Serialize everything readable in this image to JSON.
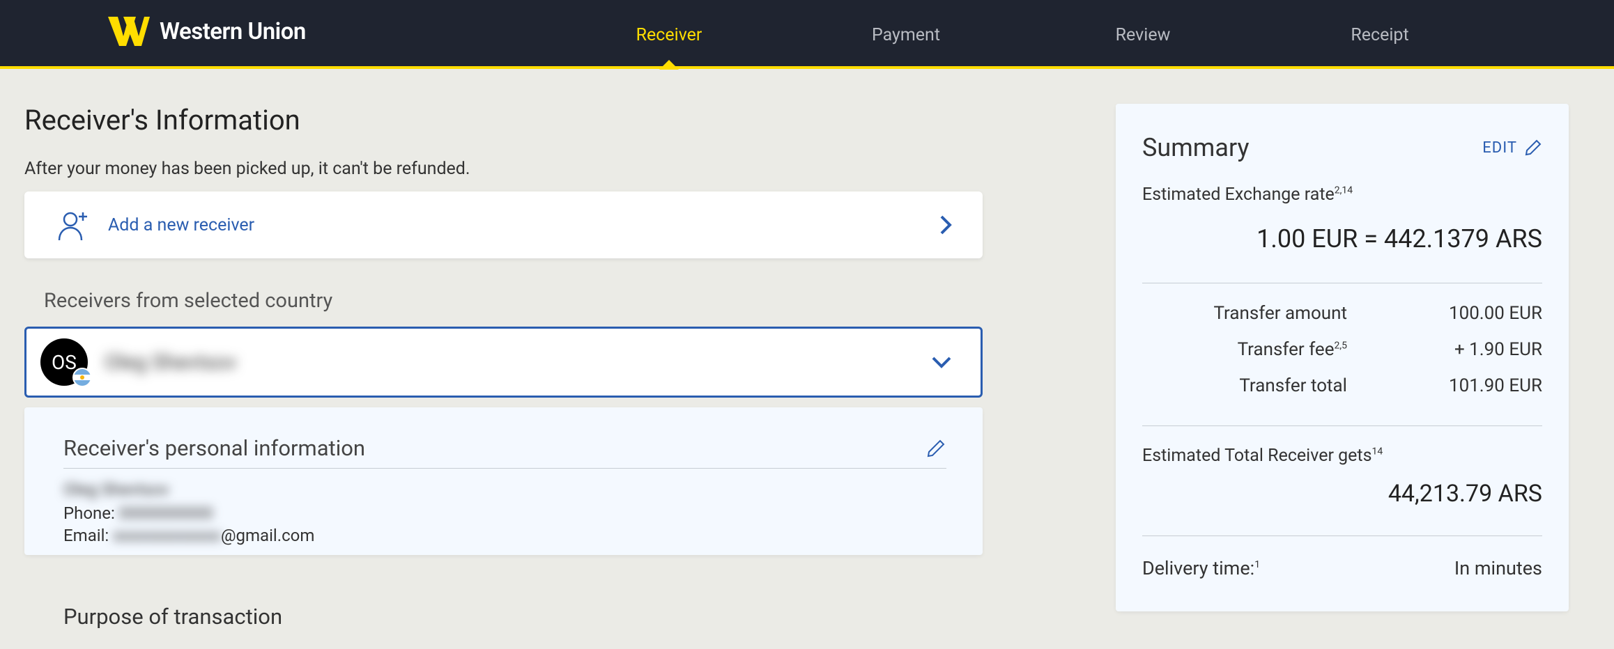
{
  "brand": {
    "name": "Western Union"
  },
  "steps": {
    "receiver": "Receiver",
    "payment": "Payment",
    "review": "Review",
    "receipt": "Receipt"
  },
  "page": {
    "title": "Receiver's Information",
    "subtitle": "After your money has been picked up, it can't be refunded."
  },
  "add_receiver": {
    "label": "Add a new receiver"
  },
  "receivers_section": {
    "label": "Receivers from selected country"
  },
  "selected_receiver": {
    "initials": "OS",
    "name": "Oleg Shevtsov"
  },
  "personal_info": {
    "heading": "Receiver's personal information",
    "name": "Oleg Shevtsov",
    "phone_label": "Phone:",
    "phone_value": "0000000000",
    "email_label": "Email:",
    "email_masked": "xxxxxxxxxxxxx",
    "email_suffix": "@gmail.com"
  },
  "purpose": {
    "heading": "Purpose of transaction"
  },
  "summary": {
    "title": "Summary",
    "edit": "EDIT",
    "exchange_label": "Estimated Exchange rate",
    "exchange_sup": "2,14",
    "rate": "1.00 EUR = 442.1379 ARS",
    "rows": {
      "transfer_amount": {
        "label": "Transfer amount",
        "value": "100.00 EUR"
      },
      "transfer_fee": {
        "label": "Transfer fee",
        "sup": "2,5",
        "value": "+ 1.90 EUR"
      },
      "transfer_total": {
        "label": "Transfer total",
        "value": "101.90 EUR"
      }
    },
    "receiver_gets_label": "Estimated Total Receiver gets",
    "receiver_gets_sup": "14",
    "receiver_gets_value": "44,213.79 ARS",
    "delivery_label": "Delivery time:",
    "delivery_sup": "1",
    "delivery_value": "In minutes"
  }
}
